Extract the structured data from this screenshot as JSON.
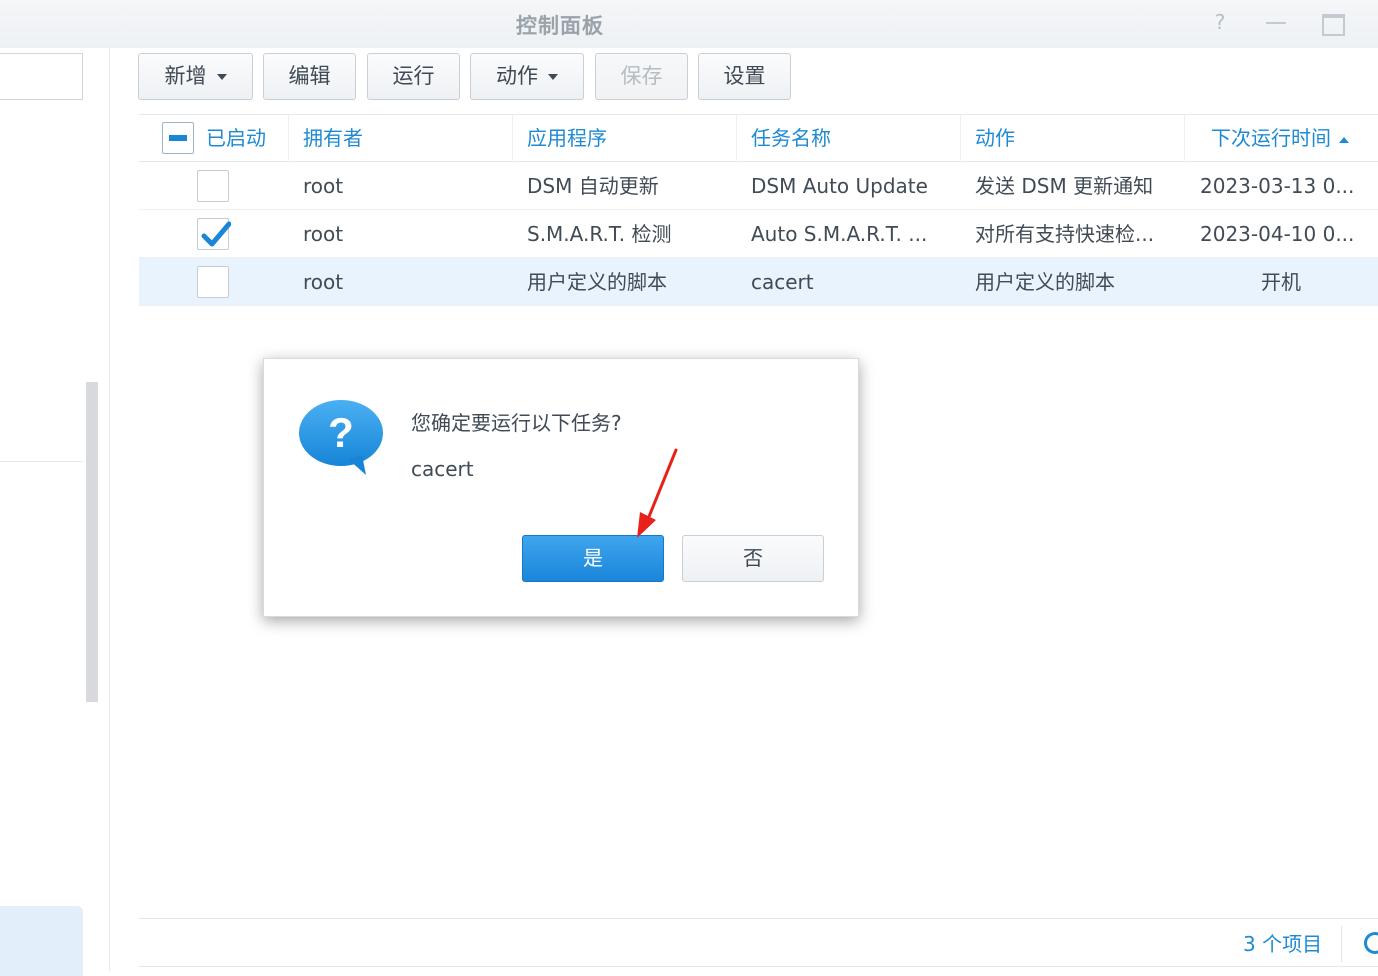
{
  "window": {
    "title": "控制面板",
    "help_glyph": "?"
  },
  "toolbar": {
    "add_label": "新增",
    "edit_label": "编辑",
    "run_label": "运行",
    "action_label": "动作",
    "save_label": "保存",
    "settings_label": "设置"
  },
  "table": {
    "columns": [
      "已启动",
      "拥有者",
      "应用程序",
      "任务名称",
      "动作",
      "下次运行时间"
    ],
    "rows": [
      {
        "enabled": false,
        "owner": "root",
        "app": "DSM 自动更新",
        "task": "DSM Auto Update",
        "action": "发送 DSM 更新通知",
        "next_run": "2023-03-13 0..."
      },
      {
        "enabled": true,
        "owner": "root",
        "app": "S.M.A.R.T. 检测",
        "task": "Auto S.M.A.R.T. ...",
        "action": "对所有支持快速检...",
        "next_run": "2023-04-10 0..."
      },
      {
        "enabled": false,
        "owner": "root",
        "app": "用户定义的脚本",
        "task": "cacert",
        "action": "用户定义的脚本",
        "next_run": "开机"
      }
    ]
  },
  "footer": {
    "item_count": "3 个项目"
  },
  "dialog": {
    "message": "您确定要运行以下任务?",
    "task_name": "cacert",
    "yes_label": "是",
    "no_label": "否",
    "icon_glyph": "?"
  },
  "colors": {
    "accent": "#1e8ad3",
    "primary_button": "#1a86d9",
    "selected_row": "#e8f3fd",
    "annotation_arrow": "#e8221b"
  }
}
